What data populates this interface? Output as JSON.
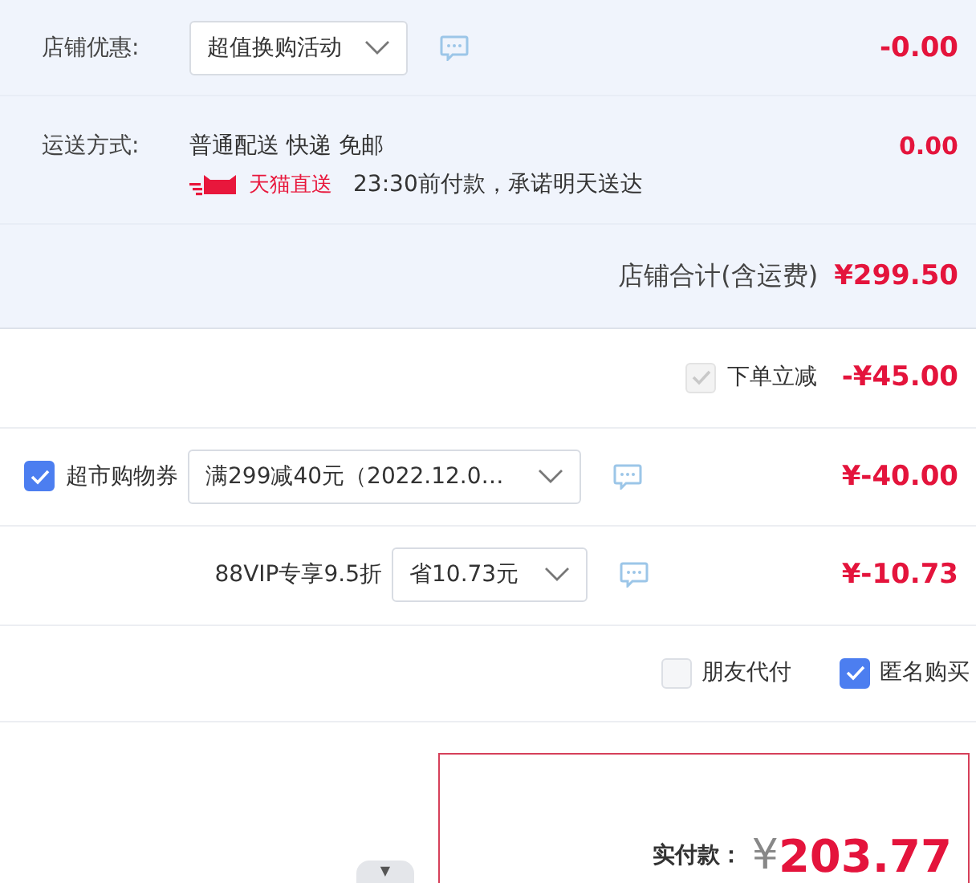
{
  "store_discount": {
    "label": "店铺优惠:",
    "dropdown": "超值换购活动",
    "amount": "-0.00"
  },
  "shipping": {
    "label": "运送方式:",
    "method": "普通配送 快递 免邮",
    "badge": "天猫直送",
    "promise": "23:30前付款，承诺明天送达",
    "amount": "0.00"
  },
  "store_total": {
    "label": "店铺合计(含运费)",
    "amount": "¥299.50"
  },
  "discounts": [
    {
      "kind": "instant",
      "label": "下单立减",
      "checked": true,
      "disabled": true,
      "amount": "-¥45.00"
    },
    {
      "kind": "coupon",
      "label": "超市购物券",
      "checked": true,
      "disabled": false,
      "dropdown": "满299减40元（2022.12.0…",
      "amount": "¥-40.00"
    },
    {
      "kind": "vip",
      "label": "88VIP专享9.5折",
      "dropdown": "省10.73元",
      "amount": "¥-10.73"
    }
  ],
  "options": [
    {
      "label": "朋友代付",
      "checked": false
    },
    {
      "label": "匿名购买",
      "checked": true
    }
  ],
  "payment": {
    "label": "实付款：",
    "currency": "¥",
    "amount": "203.77"
  },
  "collapse": {
    "icon": "▼"
  }
}
